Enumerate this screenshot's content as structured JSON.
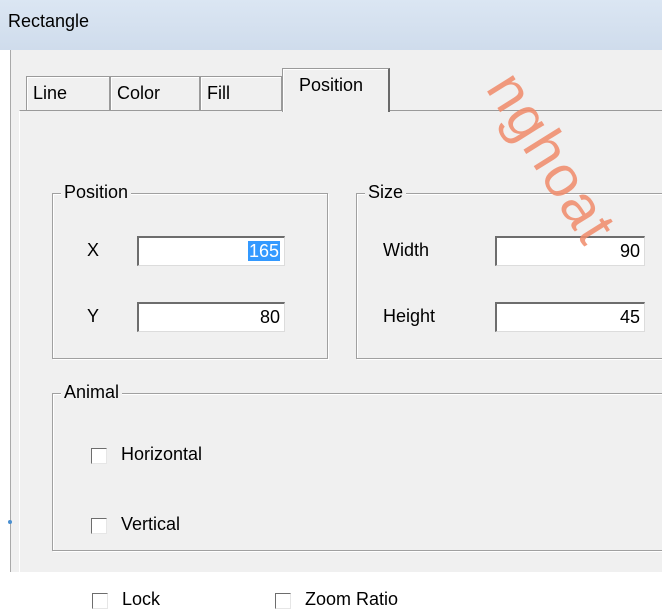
{
  "window": {
    "title": "Rectangle"
  },
  "tabs": [
    {
      "label": "Line",
      "active": false
    },
    {
      "label": "Color",
      "active": false
    },
    {
      "label": "Fill",
      "active": false
    },
    {
      "label": "Position",
      "active": true
    }
  ],
  "position_group": {
    "legend": "Position",
    "x_label": "X",
    "x_value": "165",
    "y_label": "Y",
    "y_value": "80"
  },
  "size_group": {
    "legend": "Size",
    "width_label": "Width",
    "width_value": "90",
    "height_label": "Height",
    "height_value": "45"
  },
  "animal_group": {
    "legend": "Animal",
    "horizontal_label": "Horizontal",
    "horizontal_checked": false,
    "vertical_label": "Vertical",
    "vertical_checked": false
  },
  "options": {
    "lock_label": "Lock",
    "lock_checked": false,
    "zoom_ratio_label": "Zoom Ratio",
    "zoom_ratio_checked": false
  },
  "watermark": "nghoat"
}
